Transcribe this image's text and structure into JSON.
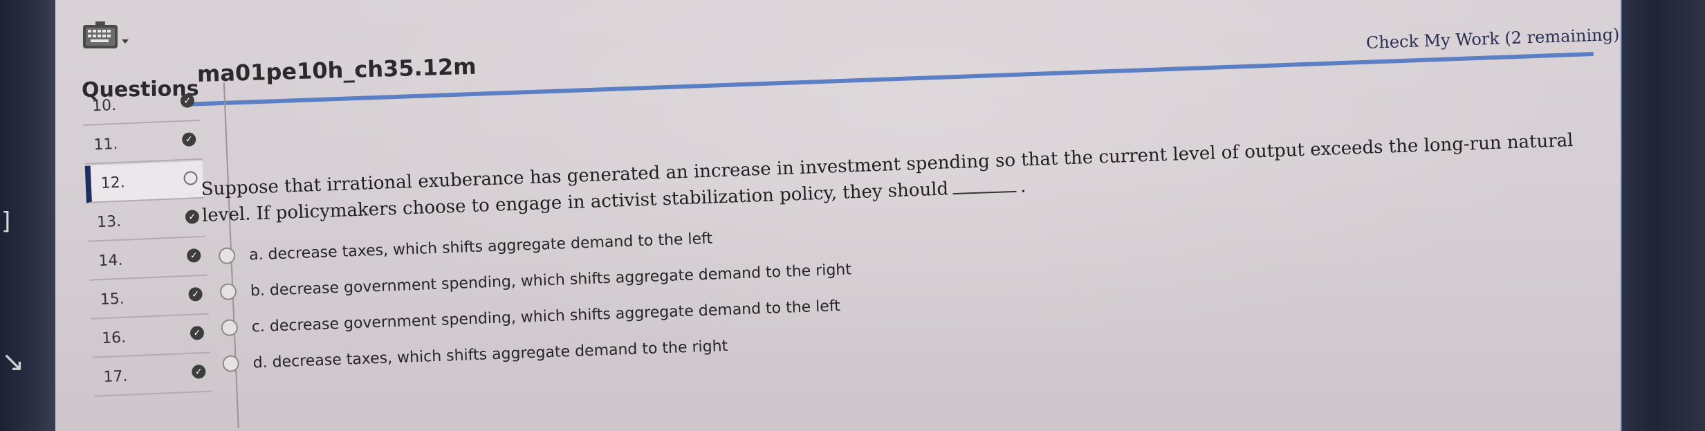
{
  "toolbar": {
    "keyboard_icon": "keyboard-icon",
    "dropdown_icon": "chevron-down-icon"
  },
  "header": {
    "questions_label": "Questions",
    "assignment_title": "ma01pe10h_ch35.12m",
    "check_work": "Check My Work (2 remaining)"
  },
  "questions": [
    {
      "number": "10.",
      "status": "complete",
      "status_icon": "check-icon"
    },
    {
      "number": "11.",
      "status": "complete",
      "status_icon": "check-icon"
    },
    {
      "number": "12.",
      "status": "current",
      "status_icon": "empty-circle-icon"
    },
    {
      "number": "13.",
      "status": "complete",
      "status_icon": "check-icon"
    },
    {
      "number": "14.",
      "status": "complete",
      "status_icon": "check-icon"
    },
    {
      "number": "15.",
      "status": "complete",
      "status_icon": "check-icon"
    },
    {
      "number": "16.",
      "status": "complete",
      "status_icon": "check-icon"
    },
    {
      "number": "17.",
      "status": "complete",
      "status_icon": "check-icon"
    }
  ],
  "question": {
    "prompt_part1": "Suppose that irrational exuberance has generated an increase in investment spending so that the current level of output exceeds the long-run natural level. If policymakers choose to engage in activist stabilization policy, they should",
    "prompt_end": ".",
    "options": [
      {
        "label": "a. decrease taxes, which shifts aggregate demand to the left"
      },
      {
        "label": "b. decrease government spending, which shifts aggregate demand to the right"
      },
      {
        "label": "c. decrease government spending, which shifts aggregate demand to the left"
      },
      {
        "label": "d. decrease taxes, which shifts aggregate demand to the right"
      }
    ]
  },
  "colors": {
    "accent": "#5a7fc4",
    "active_marker": "#1c2f5f",
    "page_bg": "#d9d2d6",
    "check_work_text": "#2b2f55"
  }
}
